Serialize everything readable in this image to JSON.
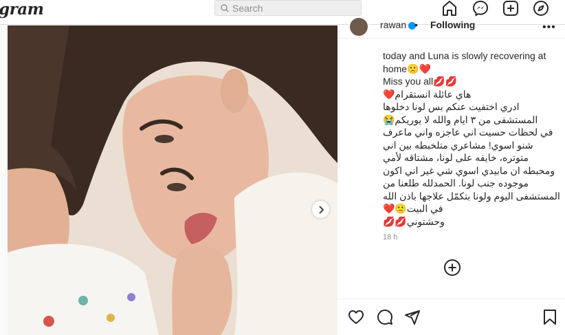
{
  "app": {
    "logo_text": "gram"
  },
  "search": {
    "placeholder": "Search"
  },
  "nav": [
    {
      "name": "home-icon"
    },
    {
      "name": "messenger-icon"
    },
    {
      "name": "new-post-icon"
    },
    {
      "name": "explore-icon"
    }
  ],
  "post": {
    "username": "rawan",
    "separator": "•",
    "follow_status": "Following",
    "caption_lines": [
      {
        "text": "today and Luna is slowly recovering at",
        "dir": "en"
      },
      {
        "text": "home🙁❤️",
        "dir": "en"
      },
      {
        "text": "Miss you all💋💋",
        "dir": "en"
      },
      {
        "text": "هاي عائلة انستقرام❤️",
        "dir": "ar"
      },
      {
        "text": "ادري اختفيت عنكم بس لونا دخلوها",
        "dir": "ar"
      },
      {
        "text": "المستشفى من ٣ ايام والله لا يوريكم😭",
        "dir": "ar"
      },
      {
        "text": "في لحظات حسيت اني عاجزه واني ماعرف",
        "dir": "ar"
      },
      {
        "text": "شنو اسوي! مشاعري متلخبطه بين اني",
        "dir": "ar"
      },
      {
        "text": "متوتره، خايفه على لونا، مشتاقه لأمي",
        "dir": "ar"
      },
      {
        "text": "ومحبطه ان مابيدي اسوي شي غير اني اكون",
        "dir": "ar"
      },
      {
        "text": "موجوده جنب لونا. الحمدلله طلعنا من",
        "dir": "ar"
      },
      {
        "text": "المستشفى اليوم ولونا بتكمّل علاجها باذن الله",
        "dir": "ar"
      },
      {
        "text": "في البيت🙁❤️",
        "dir": "ar"
      },
      {
        "text": "وحشتوني💋💋",
        "dir": "ar"
      }
    ],
    "timestamp": "18 h"
  },
  "colors": {
    "accent": "#0095f6",
    "text": "#262626",
    "muted": "#8e8e8e",
    "border": "#dbdbdb",
    "heart": "#ed4956"
  }
}
